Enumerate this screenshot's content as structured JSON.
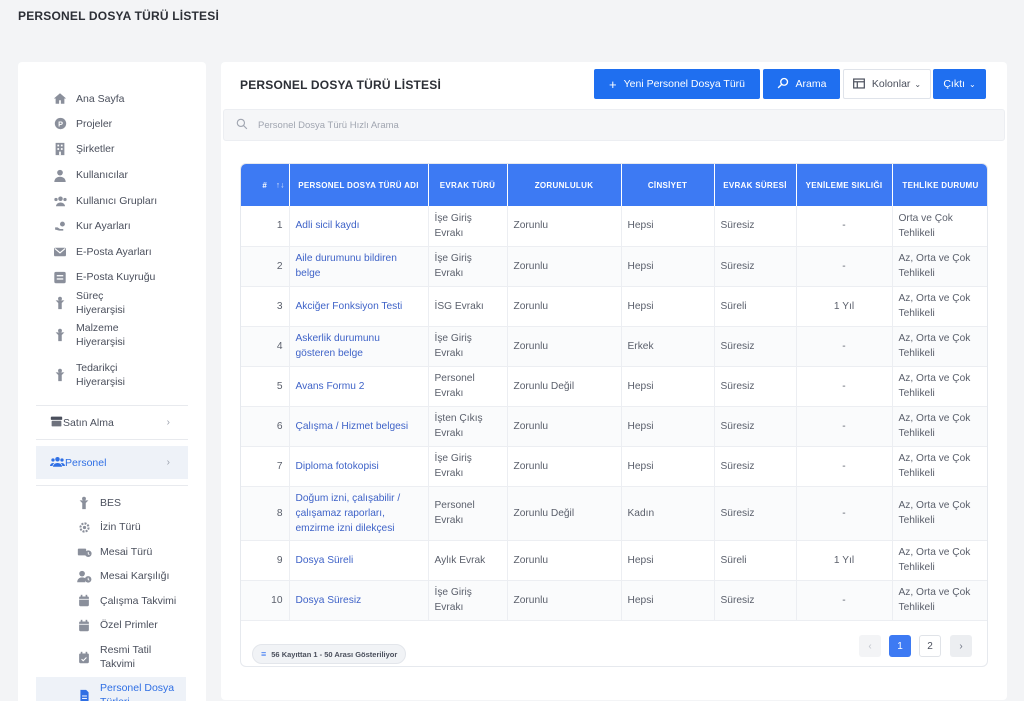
{
  "page_title": "PERSONEL DOSYA TÜRÜ LİSTESİ",
  "sidebar": {
    "items": [
      {
        "label": "Ana Sayfa",
        "icon": "home-icon"
      },
      {
        "label": "Projeler",
        "icon": "projects-icon"
      },
      {
        "label": "Şirketler",
        "icon": "building-icon"
      },
      {
        "label": "Kullanıcılar",
        "icon": "user-icon"
      },
      {
        "label": "Kullanıcı Grupları",
        "icon": "users-icon"
      },
      {
        "label": "Kur Ayarları",
        "icon": "currency-icon"
      },
      {
        "label": "E-Posta Ayarları",
        "icon": "mail-settings-icon"
      },
      {
        "label": "E-Posta Kuyruğu",
        "icon": "mail-queue-icon"
      },
      {
        "label": "Süreç Hiyerarşisi",
        "icon": "hierarchy-icon"
      },
      {
        "label": "Malzeme Hiyerarşisi",
        "icon": "hierarchy-icon"
      },
      {
        "label": "Tedarikçi Hiyerarşisi",
        "icon": "hierarchy-icon"
      }
    ],
    "groups": [
      {
        "label": "Satın Alma",
        "icon": "cart-icon"
      },
      {
        "label": "Personel",
        "icon": "people-icon"
      }
    ],
    "sub_items": [
      {
        "label": "BES",
        "icon": "hierarchy-icon"
      },
      {
        "label": "İzin Türü",
        "icon": "gear-icon"
      },
      {
        "label": "Mesai Türü",
        "icon": "clock-truck-icon"
      },
      {
        "label": "Mesai Karşılığı",
        "icon": "user-clock-icon"
      },
      {
        "label": "Çalışma Takvimi",
        "icon": "calendar-icon"
      },
      {
        "label": "Özel Primler",
        "icon": "calendar-icon"
      },
      {
        "label": "Resmi Tatil Takvimi",
        "icon": "calendar-check-icon"
      },
      {
        "label": "Personel Dosya Türleri",
        "icon": "file-icon"
      }
    ]
  },
  "card": {
    "title": "PERSONEL DOSYA TÜRÜ LİSTESİ",
    "new_button": "Yeni Personel Dosya Türü",
    "search_button": "Arama",
    "columns_button": "Kolonlar",
    "export_button": "Çıktı",
    "search_placeholder": "Personel Dosya Türü Hızlı Arama"
  },
  "table": {
    "headers": [
      "#",
      "PERSONEL DOSYA TÜRÜ ADI",
      "EVRAK TÜRÜ",
      "ZORUNLULUK",
      "CİNSİYET",
      "EVRAK SÜRESİ",
      "YENİLEME SIKLIĞI",
      "TEHLİKE DURUMU"
    ],
    "rows": [
      [
        "1",
        "Adli sicil kaydı",
        "İşe Giriş Evrakı",
        "Zorunlu",
        "Hepsi",
        "Süresiz",
        "-",
        "Orta ve Çok Tehlikeli"
      ],
      [
        "2",
        "Aile durumunu bildiren belge",
        "İşe Giriş Evrakı",
        "Zorunlu",
        "Hepsi",
        "Süresiz",
        "-",
        "Az, Orta ve Çok Tehlikeli"
      ],
      [
        "3",
        "Akciğer Fonksiyon Testi",
        "İSG Evrakı",
        "Zorunlu",
        "Hepsi",
        "Süreli",
        "1 Yıl",
        "Az, Orta ve Çok Tehlikeli"
      ],
      [
        "4",
        "Askerlik durumunu gösteren belge",
        "İşe Giriş Evrakı",
        "Zorunlu",
        "Erkek",
        "Süresiz",
        "-",
        "Az, Orta ve Çok Tehlikeli"
      ],
      [
        "5",
        "Avans Formu 2",
        "Personel Evrakı",
        "Zorunlu Değil",
        "Hepsi",
        "Süresiz",
        "-",
        "Az, Orta ve Çok Tehlikeli"
      ],
      [
        "6",
        "Çalışma / Hizmet belgesi",
        "İşten Çıkış Evrakı",
        "Zorunlu",
        "Hepsi",
        "Süresiz",
        "-",
        "Az, Orta ve Çok Tehlikeli"
      ],
      [
        "7",
        "Diploma fotokopisi",
        "İşe Giriş Evrakı",
        "Zorunlu",
        "Hepsi",
        "Süresiz",
        "-",
        "Az, Orta ve Çok Tehlikeli"
      ],
      [
        "8",
        "Doğum izni, çalışabilir / çalışamaz raporları, emzirme izni dilekçesi",
        "Personel Evrakı",
        "Zorunlu Değil",
        "Kadın",
        "Süresiz",
        "-",
        "Az, Orta ve Çok Tehlikeli"
      ],
      [
        "9",
        "Dosya Süreli",
        "Aylık Evrak",
        "Zorunlu",
        "Hepsi",
        "Süreli",
        "1 Yıl",
        "Az, Orta ve Çok Tehlikeli"
      ],
      [
        "10",
        "Dosya Süresiz",
        "İşe Giriş Evrakı",
        "Zorunlu",
        "Hepsi",
        "Süresiz",
        "-",
        "Az, Orta ve Çok Tehlikeli"
      ]
    ]
  },
  "footer": {
    "record_info": "56 Kayıttan 1 - 50 Arası Gösteriliyor",
    "pages": [
      "1",
      "2"
    ],
    "prev": "‹",
    "next": "›"
  },
  "colors": {
    "accent": "#1f6ff0",
    "header": "#3d7af3",
    "link": "#3f63c8"
  }
}
